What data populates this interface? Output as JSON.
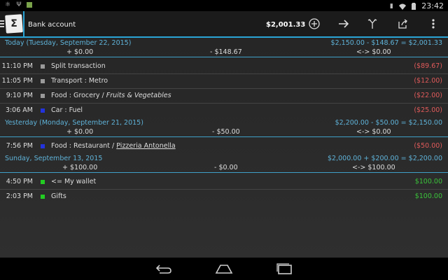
{
  "status_bar": {
    "time": "23:42",
    "left_icons": [
      "assistant-icon",
      "usb-icon",
      "app-notification-icon"
    ],
    "right_icons": [
      "vibrate-icon",
      "wifi-icon",
      "battery-icon"
    ]
  },
  "action_bar": {
    "title": "Bank account",
    "balance": "$2,001.33",
    "accent_color": "#2aa4d6",
    "actions": [
      "add-icon",
      "arrow-right-icon",
      "split-icon",
      "share-icon",
      "overflow-menu-icon"
    ]
  },
  "days": [
    {
      "date": "Today (Tuesday, September 22, 2015)",
      "calc": "$2,150.00 - $148.67 = $2,001.33",
      "income": "+ $0.00",
      "expense": "- $148.67",
      "transfer": "<-> $0.00",
      "transactions": [
        {
          "time": "11:10 PM",
          "color": "#9a9a9a",
          "category": "Split transaction",
          "sub": "",
          "sub_style": "",
          "amount": "($89.67)",
          "amount_color": "#e05a5a"
        },
        {
          "time": "11:05 PM",
          "color": "#9a9a9a",
          "category": "Transport : Metro",
          "sub": "",
          "sub_style": "",
          "amount": "($12.00)",
          "amount_color": "#e05a5a"
        },
        {
          "time": "9:10 PM",
          "color": "#9a9a9a",
          "category": "Food : Grocery / ",
          "sub": "Fruits & Vegetables",
          "sub_style": "italic",
          "amount": "($22.00)",
          "amount_color": "#e05a5a"
        },
        {
          "time": "3:06 AM",
          "color": "#2233dd",
          "category": "Car : Fuel",
          "sub": "",
          "sub_style": "",
          "amount": "($25.00)",
          "amount_color": "#e05a5a"
        }
      ]
    },
    {
      "date": "Yesterday (Monday, September 21, 2015)",
      "calc": "$2,200.00 - $50.00 = $2,150.00",
      "income": "+ $0.00",
      "expense": "- $50.00",
      "transfer": "<-> $0.00",
      "transactions": [
        {
          "time": "7:56 PM",
          "color": "#2233dd",
          "category": "Food : Restaurant / ",
          "sub": "Pizzeria Antonella",
          "sub_style": "underline",
          "amount": "($50.00)",
          "amount_color": "#e05a5a"
        }
      ]
    },
    {
      "date": "Sunday, September 13, 2015",
      "calc": "$2,000.00 + $200.00 = $2,200.00",
      "income": "+ $100.00",
      "expense": "- $0.00",
      "transfer": "<-> $100.00",
      "transactions": [
        {
          "time": "4:50 PM",
          "color": "#22cc22",
          "category": "<= My wallet",
          "sub": "",
          "sub_style": "",
          "amount": "$100.00",
          "amount_color": "#3ac43a"
        },
        {
          "time": "2:03 PM",
          "color": "#22cc22",
          "category": "Gifts",
          "sub": "",
          "sub_style": "",
          "amount": "$100.00",
          "amount_color": "#3ac43a"
        }
      ]
    }
  ],
  "nav_bar": {
    "buttons": [
      "back-icon",
      "home-icon",
      "recent-apps-icon"
    ]
  }
}
